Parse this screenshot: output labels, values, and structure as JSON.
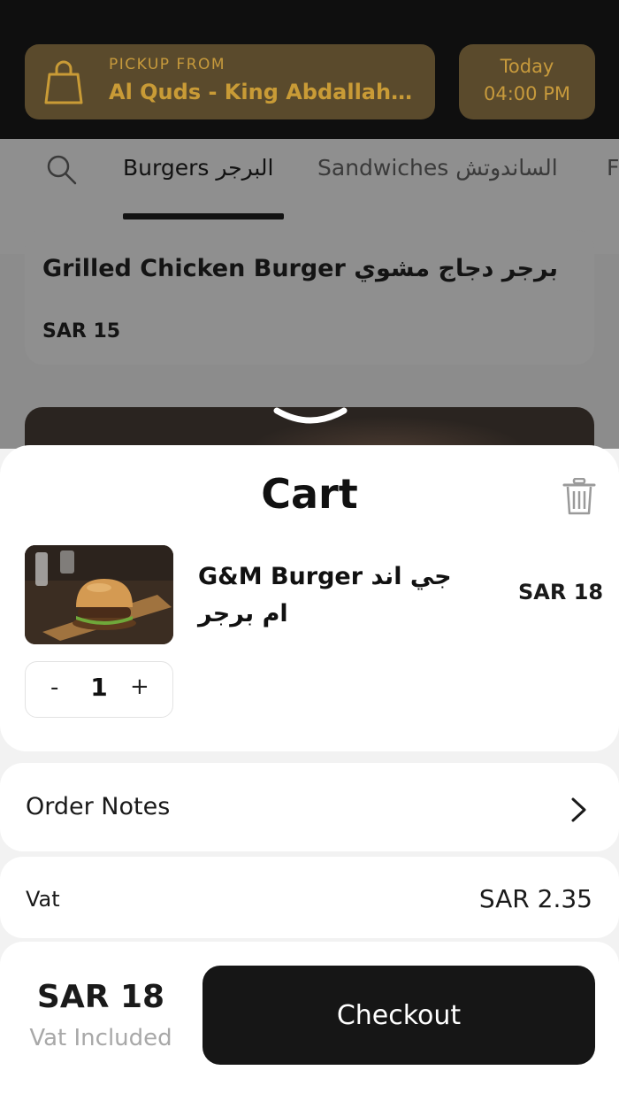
{
  "header": {
    "pickup_label": "PICKUP FROM",
    "pickup_location": "Al Quds - King Abdallah R...",
    "time_day": "Today",
    "time_value": "04:00 PM",
    "accent_color": "#c99b36"
  },
  "tabs": [
    {
      "label": "Burgers البرجر",
      "selected": true
    },
    {
      "label": "Sandwiches الساندوتش",
      "selected": false
    },
    {
      "label": "F",
      "selected": false
    }
  ],
  "menu": {
    "item_name": "Grilled Chicken Burger برجر دجاج مشوي",
    "item_price": "SAR 15"
  },
  "cart": {
    "title": "Cart",
    "items": [
      {
        "name": "G&M Burger جي اند ام برجر",
        "price": "SAR 18",
        "quantity": "1"
      }
    ],
    "stepper_minus": "-",
    "stepper_plus": "+"
  },
  "order_notes": {
    "label": "Order Notes"
  },
  "vat": {
    "label": "Vat",
    "value": "SAR 2.35"
  },
  "footer": {
    "total": "SAR 18",
    "total_sub": "Vat Included",
    "checkout_label": "Checkout"
  },
  "icons": {
    "pickup": "shopping-bag-icon",
    "search": "search-icon",
    "collapse": "chevron-down-icon",
    "delete": "trash-icon",
    "notes": "chevron-right-icon"
  }
}
